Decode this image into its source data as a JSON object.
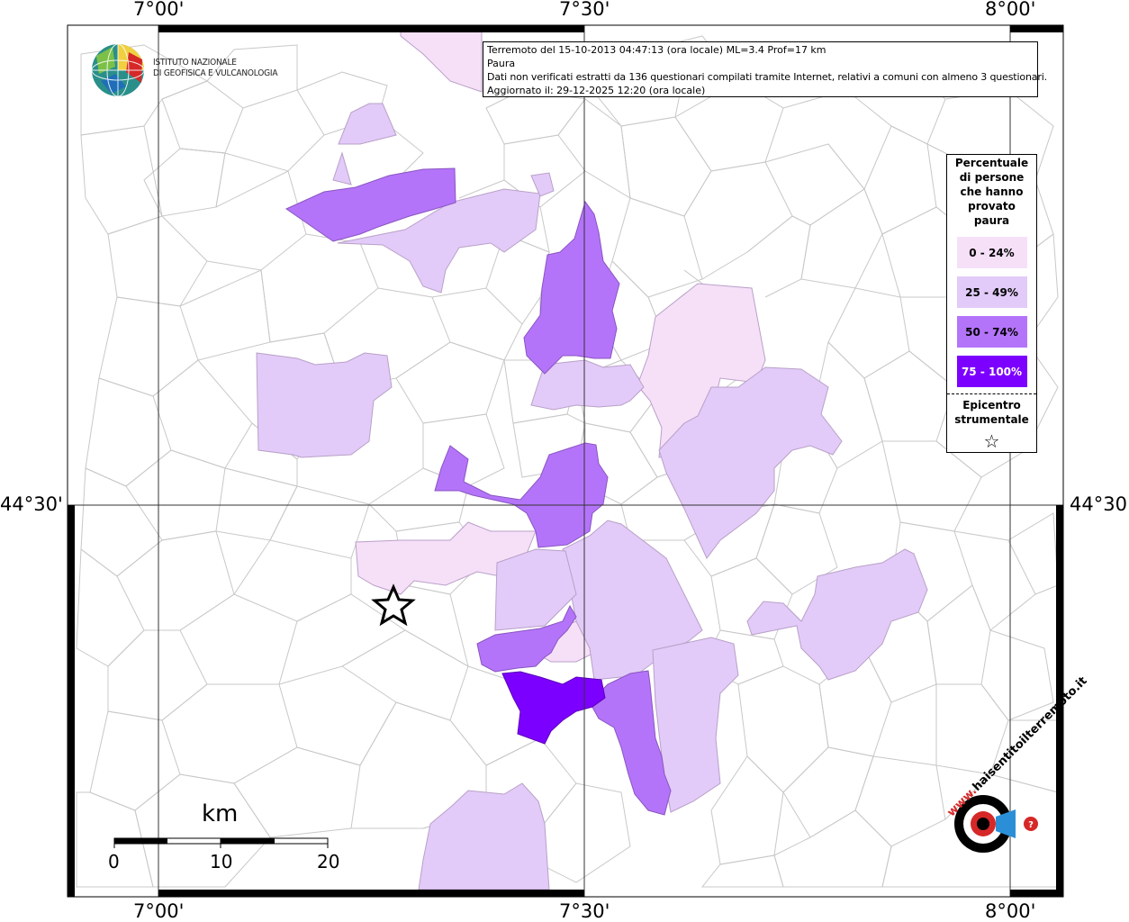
{
  "coordinates": {
    "lon_labels": [
      "7°00'",
      "7°30'",
      "8°00'"
    ],
    "lat_label": "44°30'"
  },
  "logo": {
    "line1": "ISTITUTO NAZIONALE",
    "line2": "DI GEOFISICA E VULCANOLOGIA"
  },
  "info": {
    "line1": "Terremoto del 15-10-2013 04:47:13 (ora locale) ML=3.4 Prof=17 km",
    "line2": "Paura",
    "line3": "Dati non verificati estratti da 136 questionari compilati tramite Internet, relativi a comuni con almeno 3 questionari.",
    "line4": "Aggiornato il: 29-12-2025 12:20 (ora locale)"
  },
  "legend": {
    "title": "Percentuale di persone che hanno provato paura",
    "classes": [
      {
        "label": "0 - 24%",
        "color": "#f6e0f8"
      },
      {
        "label": "25 - 49%",
        "color": "#e2cbf8"
      },
      {
        "label": "50 - 74%",
        "color": "#b474fa"
      },
      {
        "label": "75 - 100%",
        "color": "#7c00ff"
      }
    ],
    "epicenter_label": "Epicentro strumentale",
    "epicenter_symbol": "☆"
  },
  "scale": {
    "unit": "km",
    "ticks": [
      "0",
      "10",
      "20"
    ]
  },
  "badge": {
    "text": "haisentitoilterremoto.it",
    "prefix": "www."
  }
}
